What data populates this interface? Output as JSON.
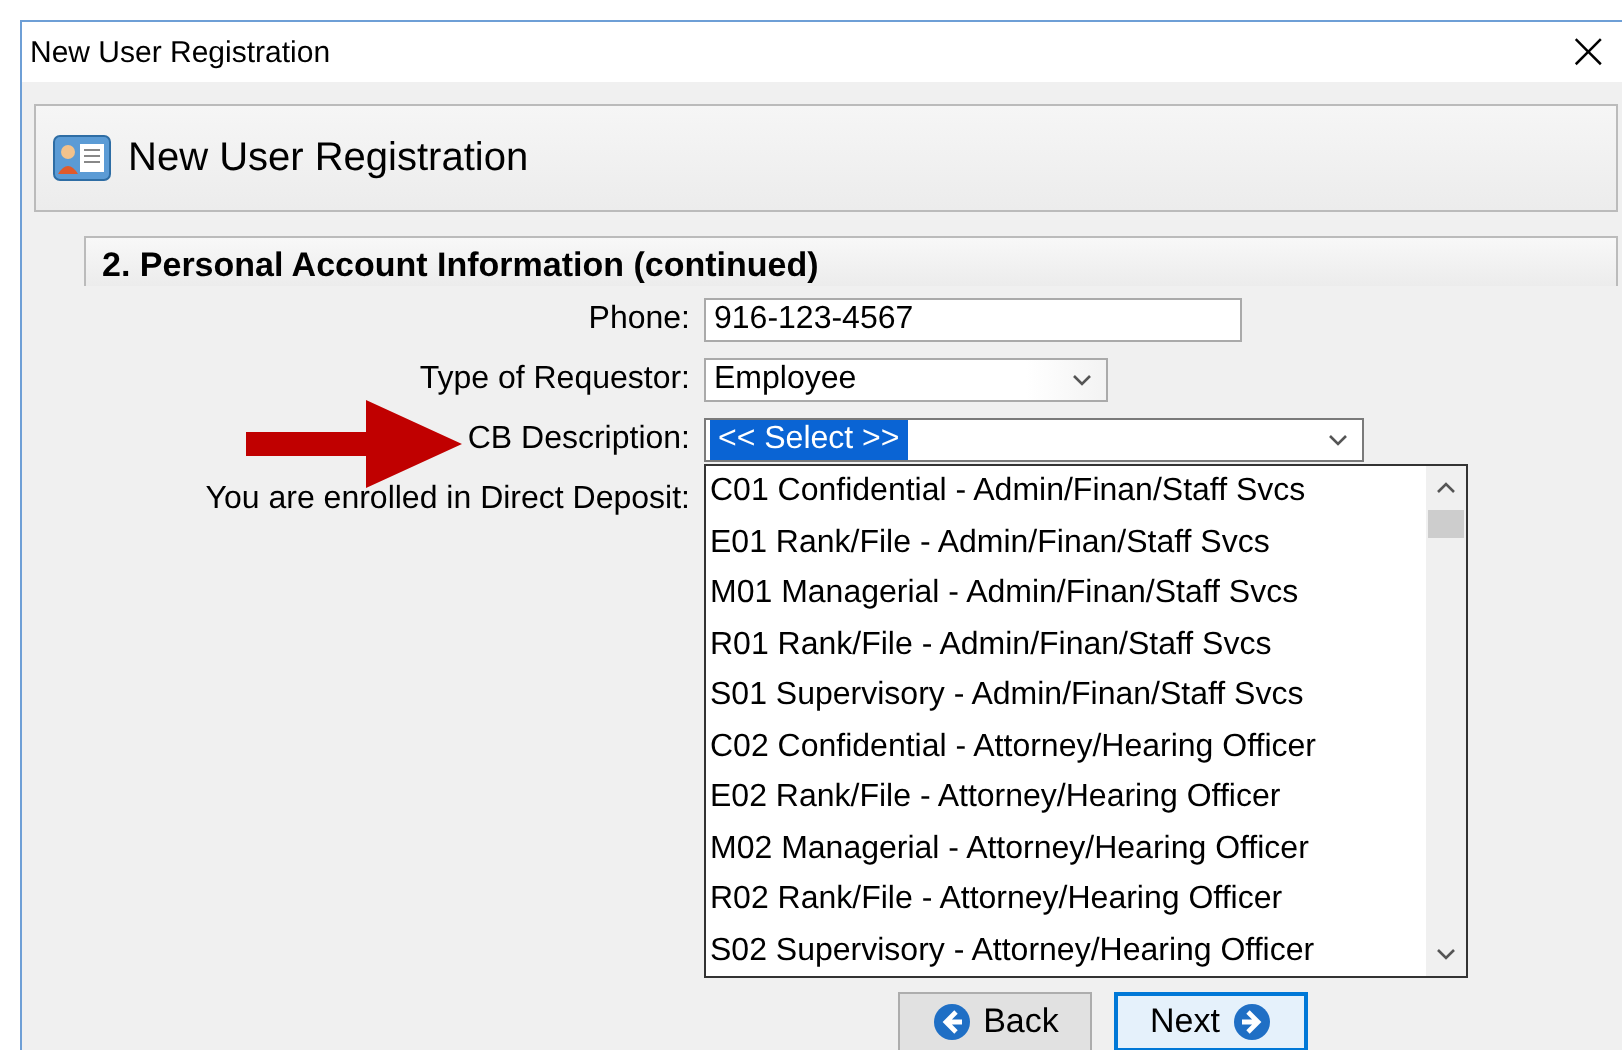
{
  "window": {
    "title": "New User Registration",
    "close": "×"
  },
  "header": {
    "title": "New User Registration"
  },
  "section": {
    "title": "2. Personal Account Information (continued)"
  },
  "fields": [
    {
      "kind": "text",
      "label": "Phone:",
      "value": "916-123-4567"
    },
    {
      "kind": "select",
      "label": "Type of Requestor:",
      "value": "Employee"
    },
    {
      "kind": "select",
      "label": "CB Description:",
      "value": "<< Select >>",
      "expanded": true,
      "highlighted": true,
      "pointer": true
    },
    {
      "kind": "label",
      "label": "You are enrolled in Direct Deposit:"
    }
  ],
  "dropdown": {
    "items": [
      {
        "label": "C01 Confidential - Admin/Finan/Staff Svcs",
        "selected": false
      },
      {
        "label": "E01 Rank/File - Admin/Finan/Staff Svcs",
        "selected": false
      },
      {
        "label": "M01 Managerial - Admin/Finan/Staff Svcs",
        "selected": false
      },
      {
        "label": "R01 Rank/File - Admin/Finan/Staff Svcs",
        "selected": false
      },
      {
        "label": "S01 Supervisory - Admin/Finan/Staff Svcs",
        "selected": false
      },
      {
        "label": "C02 Confidential - Attorney/Hearing Officer",
        "selected": false
      },
      {
        "label": "E02 Rank/File - Attorney/Hearing Officer",
        "selected": false
      },
      {
        "label": "M02 Managerial - Attorney/Hearing Officer",
        "selected": false
      },
      {
        "label": "R02 Rank/File - Attorney/Hearing Officer",
        "selected": false
      },
      {
        "label": "S02 Supervisory - Attorney/Hearing Officer",
        "selected": false
      }
    ]
  },
  "buttons": [
    {
      "kind": "back",
      "label": "Back",
      "focused": false
    },
    {
      "kind": "next",
      "label": "Next",
      "focused": true
    }
  ]
}
